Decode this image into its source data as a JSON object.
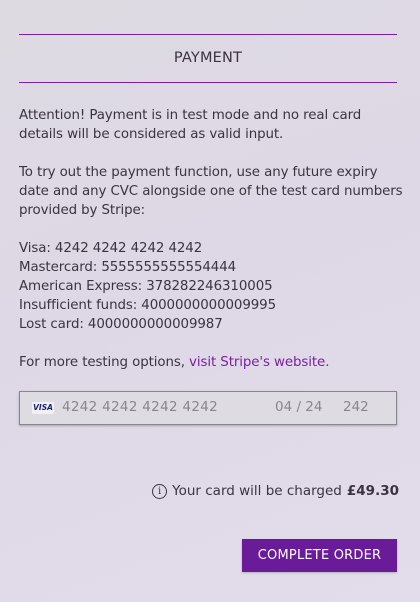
{
  "section": {
    "title": "PAYMENT"
  },
  "notice": {
    "attention": "Attention! Payment is in test mode and no real card details will be considered as valid input.",
    "instructions": "To try out the payment function, use any future expiry date and any CVC alongside one of the test card numbers provided by Stripe:",
    "test_cards": [
      "Visa: 4242 4242 4242 4242",
      "Mastercard: 5555555555554444",
      "American Express: 378282246310005",
      "Insufficient funds: 4000000000009995",
      "Lost card: 4000000000009987"
    ],
    "more_prefix": "For more testing options, ",
    "more_link": "visit Stripe's website."
  },
  "card_input": {
    "brand_icon": "visa-icon",
    "brand_label": "VISA",
    "number": "4242 4242 4242 4242",
    "expiry": "04 / 24",
    "cvc": "242"
  },
  "charge": {
    "icon": "info-icon",
    "text": "Your card will be charged",
    "amount": "£49.30"
  },
  "actions": {
    "complete_label": "COMPLETE ORDER"
  },
  "colors": {
    "accent": "#6a1b9a",
    "link": "#7b1fa2",
    "text": "#3b3440"
  }
}
